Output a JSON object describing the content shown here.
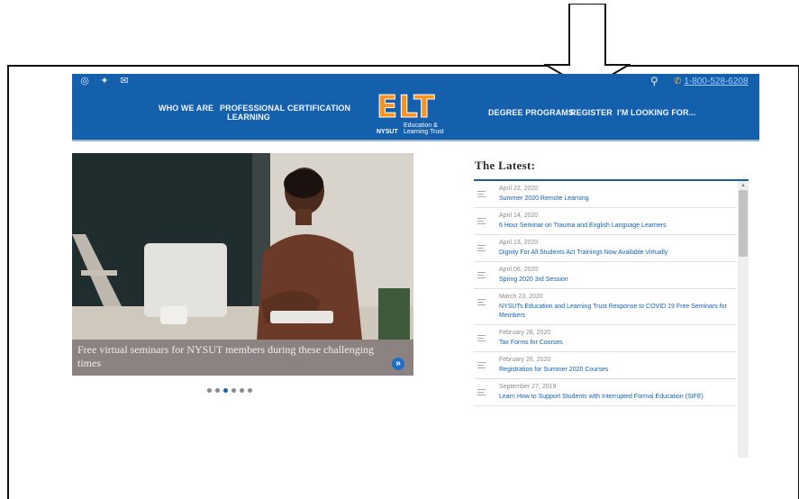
{
  "topbar": {
    "social": [
      {
        "icon": "instagram-icon",
        "glyph": "◎"
      },
      {
        "icon": "twitter-icon",
        "glyph": "✦"
      },
      {
        "icon": "mail-icon",
        "glyph": "✉"
      }
    ],
    "search_glyph": "⚲",
    "phone_glyph": "✆",
    "phone": "1-800-528-6208"
  },
  "nav": {
    "left": [
      "WHO WE ARE",
      "PROFESSIONAL LEARNING",
      "CERTIFICATION"
    ],
    "right": [
      "DEGREE PROGRAMS",
      "REGISTER",
      "I'M LOOKING FOR..."
    ],
    "logo_text": "ELT",
    "logo_sub": "Education & Learning Trust",
    "logo_org": "NYSUT"
  },
  "slider": {
    "caption": "Free virtual seminars for NYSUT members during these challenging times",
    "next_glyph": "»",
    "dot_count": 6,
    "active_dot": 2
  },
  "latest": {
    "title": "The Latest:",
    "items": [
      {
        "date": "April 22, 2020",
        "title": "Summer 2020 Remote Learning"
      },
      {
        "date": "April 14, 2020",
        "title": "6 Hour Seminar on Trauma and English Language Learners"
      },
      {
        "date": "April 13, 2020",
        "title": "Dignity For All Students Act Trainings Now Available Virtually"
      },
      {
        "date": "April 06, 2020",
        "title": "Spring 2020 3rd Session"
      },
      {
        "date": "March 23, 2020",
        "title": "NYSUTs Education and Learning Trust Response to COVID 19 Free Seminars for Members"
      },
      {
        "date": "February 28, 2020",
        "title": "Tax Forms for Courses"
      },
      {
        "date": "February 26, 2020",
        "title": "Registration for Summer 2020 Courses"
      },
      {
        "date": "September 27, 2019",
        "title": "Learn How to Support Students with Interrupted Formal Education (SIFE)"
      }
    ]
  },
  "colors": {
    "brand_blue": "#1560ac",
    "logo_orange": "#f7931e",
    "caption_bg": "#8d8282"
  }
}
